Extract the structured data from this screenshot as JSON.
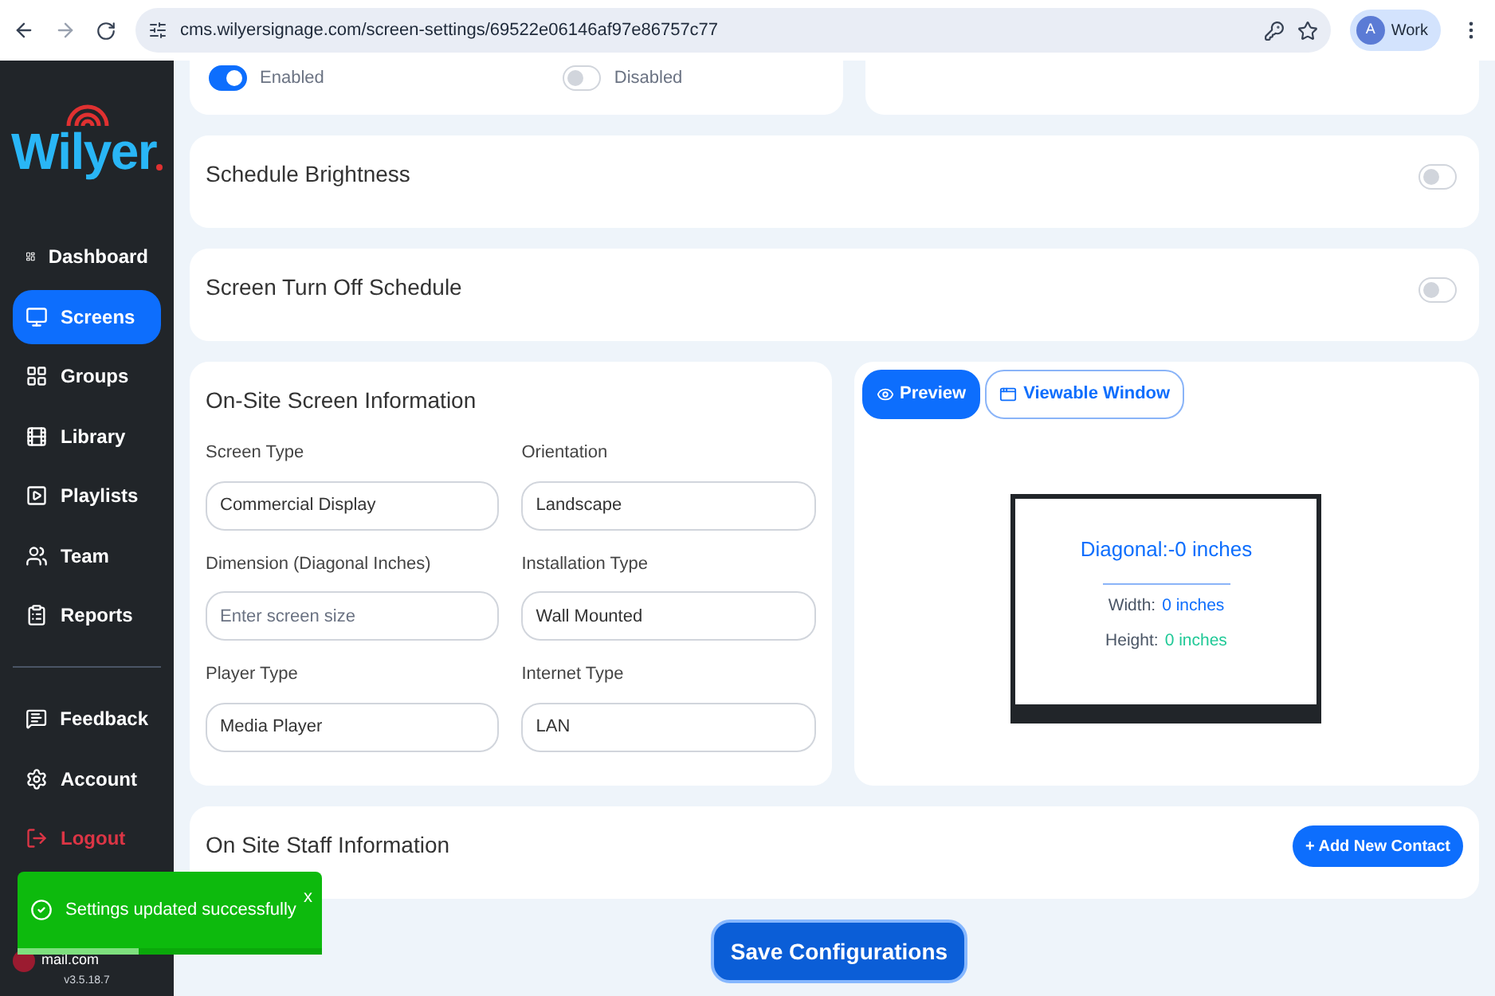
{
  "browser": {
    "url": "cms.wilyersignage.com/screen-settings/69522e06146af97e86757c77",
    "profile_initial": "A",
    "profile_label": "Work"
  },
  "sidebar": {
    "logo": "Wilyer",
    "items": [
      {
        "label": "Dashboard",
        "selected": false
      },
      {
        "label": "Screens",
        "selected": true
      },
      {
        "label": "Groups",
        "selected": false
      },
      {
        "label": "Library",
        "selected": false
      },
      {
        "label": "Playlists",
        "selected": false
      },
      {
        "label": "Team",
        "selected": false
      }
    ],
    "items_after": [
      {
        "label": "Reports",
        "selected": false
      }
    ],
    "bottom_items": [
      {
        "label": "Feedback",
        "selected": false,
        "danger": false
      },
      {
        "label": "Account",
        "selected": false,
        "danger": false
      },
      {
        "label": "Logout",
        "selected": false,
        "danger": true
      }
    ],
    "user_email": "mail.com",
    "version": "v3.5.18.7"
  },
  "top_toggles": [
    {
      "label": "Enabled",
      "on": true
    },
    {
      "label": "Disabled",
      "on": false
    }
  ],
  "schedule_cards": [
    {
      "title": "Schedule Brightness",
      "on": false
    },
    {
      "title": "Screen Turn Off Schedule",
      "on": false
    }
  ],
  "onsite_info": {
    "title": "On-Site Screen Information",
    "fields": [
      {
        "label": "Screen Type",
        "value": "Commercial Display"
      },
      {
        "label": "Orientation",
        "value": "Landscape"
      },
      {
        "label": "Dimension (Diagonal Inches)",
        "placeholder": "Enter screen size"
      },
      {
        "label": "Installation Type",
        "value": "Wall Mounted"
      },
      {
        "label": "Player Type",
        "value": "Media Player"
      },
      {
        "label": "Internet Type",
        "value": "LAN"
      }
    ]
  },
  "preview": {
    "tabs": [
      {
        "label": "Preview",
        "selected": true
      },
      {
        "label": "Viewable Window",
        "selected": false
      }
    ],
    "diagonal": "Diagonal:-0 inches",
    "width_label": "Width:",
    "width_value": "0 inches",
    "height_label": "Height:",
    "height_value": "0 inches"
  },
  "staff": {
    "title": "On Site Staff Information",
    "button": "+ Add New Contact"
  },
  "save_button": "Save Configurations",
  "toast": {
    "message": "Settings updated successfully",
    "close": "x",
    "level": 0.4
  }
}
